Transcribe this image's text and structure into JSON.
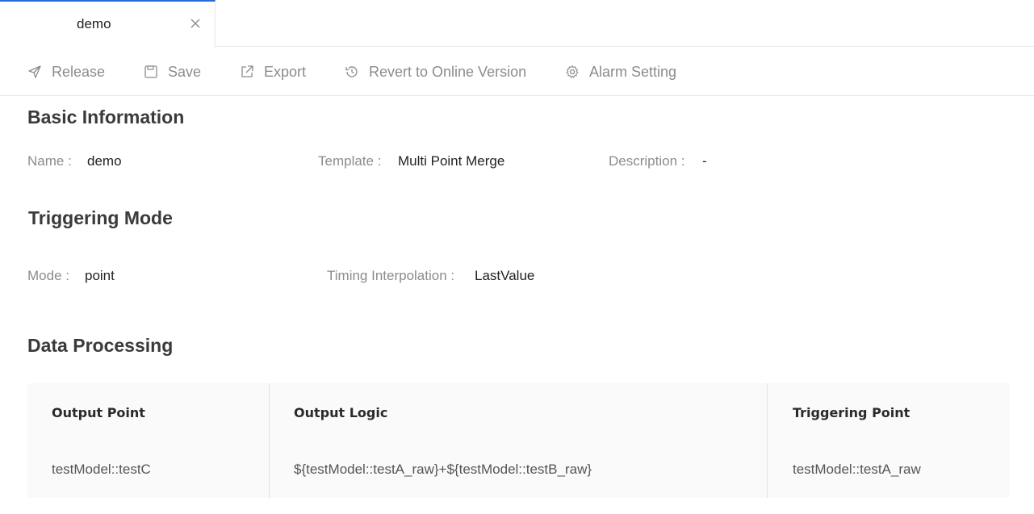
{
  "tab": {
    "label": "demo"
  },
  "toolbar": {
    "release": "Release",
    "save": "Save",
    "export": "Export",
    "revert": "Revert to Online Version",
    "alarm": "Alarm Setting"
  },
  "basic": {
    "title": "Basic Information",
    "name_label": "Name :",
    "name_value": "demo",
    "template_label": "Template :",
    "template_value": "Multi Point Merge",
    "description_label": "Description :",
    "description_value": "-"
  },
  "trigger": {
    "title": "Triggering Mode",
    "mode_label": "Mode :",
    "mode_value": "point",
    "interp_label": "Timing Interpolation :",
    "interp_value": "LastValue"
  },
  "processing": {
    "title": "Data Processing",
    "columns": [
      "Output Point",
      "Output Logic",
      "Triggering Point"
    ],
    "rows": [
      [
        "testModel::testC",
        "${testModel::testA_raw}+${testModel::testB_raw}",
        "testModel::testA_raw"
      ]
    ]
  },
  "colors": {
    "accent": "#1a6cf5",
    "muted": "#8c8c8c",
    "table_bg": "#fafafa"
  },
  "icons": {
    "release": "send-icon",
    "save": "save-icon",
    "export": "export-icon",
    "revert": "history-icon",
    "alarm": "gear-icon",
    "close": "close-icon"
  }
}
